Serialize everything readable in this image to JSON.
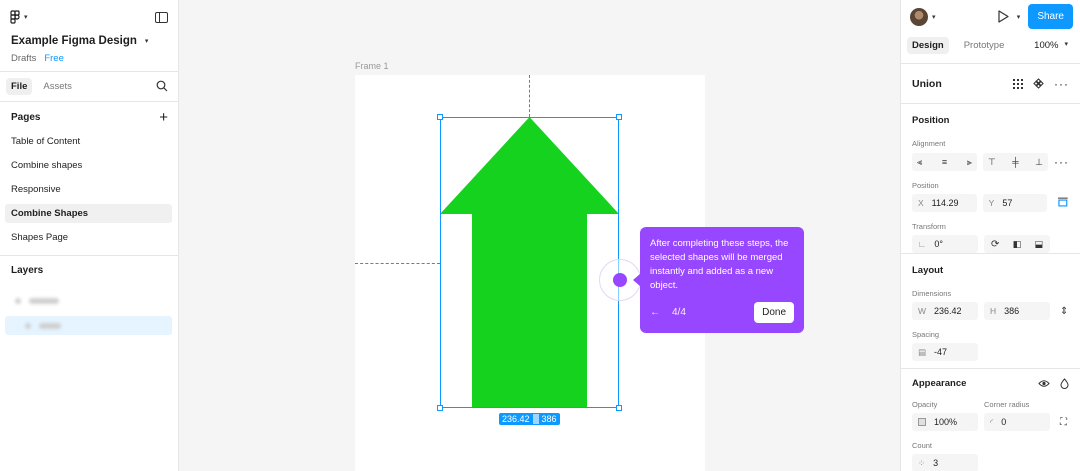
{
  "file": {
    "name": "Example Figma Design",
    "location": "Drafts",
    "plan": "Free"
  },
  "left_tabs": {
    "file": "File",
    "assets": "Assets"
  },
  "pages": {
    "title": "Pages",
    "items": [
      "Table of Content",
      "Combine shapes",
      "Responsive",
      "Combine Shapes",
      "Shapes Page"
    ],
    "active_index": 3
  },
  "layers": {
    "title": "Layers"
  },
  "canvas": {
    "frame_label": "Frame 1",
    "selection_width": "236.42",
    "selection_height": "386",
    "shape_color": "#14d21e"
  },
  "tooltip": {
    "message": "After completing these steps, the selected shapes will be merged instantly and added as a new object.",
    "step": "4/4",
    "done": "Done",
    "color": "#9747ff"
  },
  "right": {
    "share": "Share",
    "tabs": {
      "design": "Design",
      "prototype": "Prototype"
    },
    "zoom": "100%",
    "layer_name": "Union",
    "position": {
      "title": "Position",
      "alignment_label": "Alignment",
      "position_label": "Position",
      "x_label": "X",
      "x": "114.29",
      "y_label": "Y",
      "y": "57",
      "transform_label": "Transform",
      "rotation": "0°"
    },
    "layout": {
      "title": "Layout",
      "dimensions_label": "Dimensions",
      "w_label": "W",
      "w": "236.42",
      "h_label": "H",
      "h": "386",
      "spacing_label": "Spacing",
      "spacing": "-47"
    },
    "appearance": {
      "title": "Appearance",
      "opacity_label": "Opacity",
      "opacity": "100%",
      "radius_label": "Corner radius",
      "radius": "0",
      "count_label": "Count",
      "count": "3"
    }
  }
}
